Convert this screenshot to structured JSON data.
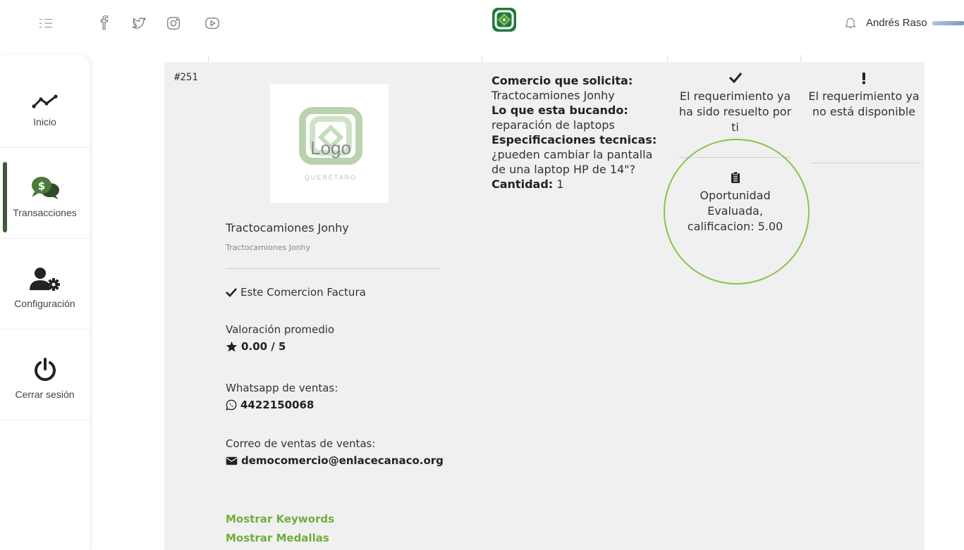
{
  "header": {
    "user_name": "Andrés Raso",
    "icons": [
      "menu-icon",
      "facebook-icon",
      "twitter-icon",
      "instagram-icon",
      "youtube-icon",
      "bell-icon"
    ]
  },
  "sidebar": {
    "items": [
      {
        "label": "Inicio",
        "icon": "trend-line-icon"
      },
      {
        "label": "Transacciones",
        "icon": "money-chat-icon",
        "active": true
      },
      {
        "label": "Configuración",
        "icon": "user-gear-icon"
      },
      {
        "label": "Cerrar sesión",
        "icon": "power-icon"
      }
    ]
  },
  "row": {
    "id": "#251",
    "company": {
      "logo_text": "Logo",
      "logo_caption": "QUERÉTARO",
      "name": "Tractocamiones Jonhy",
      "subname": "Tractocamiones Jonhy",
      "factura": "Este Comercion Factura",
      "rating_label": "Valoración promedio",
      "rating_value": "0.00 / 5",
      "whatsapp_label": "Whatsapp de ventas:",
      "whatsapp_value": "4422150068",
      "email_label": "Correo de ventas de ventas:",
      "email_value": "democomercio@enlacecanaco.org",
      "show_keywords": "Mostrar Keywords",
      "show_medals": "Mostrar Medallas"
    },
    "request": {
      "requester_label": "Comercio que solicita:",
      "requester_value": "Tractocamiones Jonhy",
      "looking_label": "Lo que esta bucando:",
      "looking_value": "reparación de laptops",
      "specs_label": "Especificaciones tecnicas:",
      "specs_value": "¿pueden cambiar la pantalla de una laptop HP de 14\"?",
      "qty_label": "Cantidad:",
      "qty_value": "1"
    },
    "status_resolved": "El requerimiento ya ha sido resuelto por ti",
    "status_evaluated": "Oportunidad Evaluada, calificacion: 5.00",
    "status_unavailable": "El requerimiento ya no está disponible"
  },
  "colors": {
    "accent_green": "#6fae3c",
    "brand_dark_green": "#3f5a37",
    "highlight_circle": "#8bc34a"
  }
}
